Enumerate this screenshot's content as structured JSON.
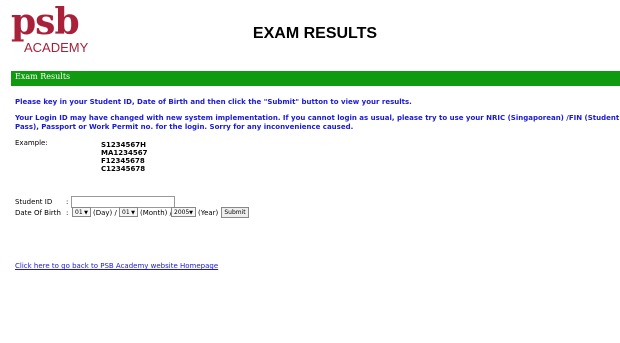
{
  "logo": {
    "primary": "psb",
    "secondary": "ACADEMY"
  },
  "page_title": "EXAM RESULTS",
  "section_bar": {
    "label": "Exam Results"
  },
  "instructions": {
    "line1": "Please key in your Student ID, Date of Birth and then click the \"Submit\" button to view your results.",
    "line2": "Your Login ID may have changed with new system implementation. If you cannot login as usual, please try to use your NRIC (Singaporean) /FIN (Student Pass), Passport or Work Permit no. for the login. Sorry for any inconvenience caused."
  },
  "example": {
    "label": "Example:",
    "ids": [
      "S1234567H",
      "MA1234567",
      "F12345678",
      "C12345678"
    ]
  },
  "form": {
    "student_id_label": "Student ID",
    "dob_label": "Date Of Birth",
    "colon": ":",
    "student_id_value": "",
    "day_value": "01",
    "day_suffix": "(Day) /",
    "month_value": "01",
    "month_suffix": "(Month) /",
    "year_value": "2005",
    "year_suffix": "(Year)",
    "submit_label": "Submit"
  },
  "home_link": "Click here to go back to PSB Academy website Homepage",
  "colors": {
    "brand": "#a8203a",
    "bar": "#109a10",
    "link": "#1a1ad6"
  }
}
